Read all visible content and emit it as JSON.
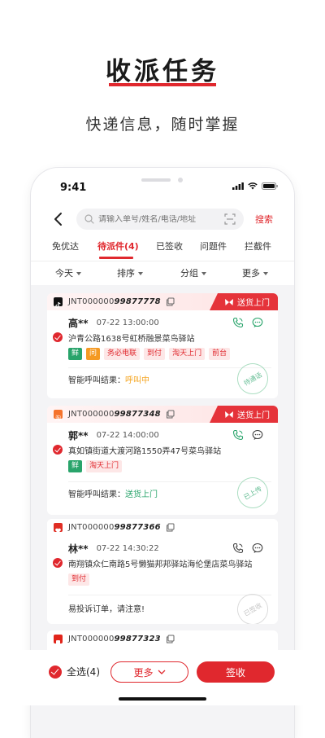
{
  "hero": {
    "title": "收派任务",
    "subtitle": "快递信息，随时掌握"
  },
  "status_bar": {
    "time": "9:41"
  },
  "search": {
    "placeholder": "请输入单号/姓名/电话/地址",
    "search_label": "搜索"
  },
  "tabs": [
    {
      "label": "免优达",
      "active": false
    },
    {
      "label": "待派件(4)",
      "active": true
    },
    {
      "label": "已签收",
      "active": false
    },
    {
      "label": "问题件",
      "active": false
    },
    {
      "label": "拦截件",
      "active": false
    }
  ],
  "filters": [
    "今天",
    "排序",
    "分组",
    "更多"
  ],
  "cards": [
    {
      "brand_icon": "tiktok-icon",
      "waybill_prefix": "JNT000000",
      "waybill_suffix": "99877778",
      "ribbon": "送货上门",
      "name": "高**",
      "time": "07-22 13:00:00",
      "address": "沪青公路1638号虹桥融景菜鸟驿站",
      "tags": [
        {
          "text": "鲜",
          "style": "green"
        },
        {
          "text": "问",
          "style": "orange"
        },
        {
          "text": "务必电联",
          "style": "red"
        },
        {
          "text": "到付",
          "style": "red"
        },
        {
          "text": "淘天上门",
          "style": "red"
        },
        {
          "text": "前台",
          "style": "red"
        }
      ],
      "result_label": "智能呼叫结果：",
      "result_value": "呼叫中",
      "stamp": "待通话"
    },
    {
      "brand_icon": "taobao-icon",
      "waybill_prefix": "JNT000000",
      "waybill_suffix": "99877348",
      "ribbon": "送货上门",
      "name": "郭**",
      "time": "07-22 14:00:00",
      "address": "真如镇街道大渡河路1550弄47号菜鸟驿站",
      "tags": [
        {
          "text": "鲜",
          "style": "green"
        },
        {
          "text": "淘天上门",
          "style": "red"
        }
      ],
      "result_label": "智能呼叫结果：",
      "result_value": "送货上门",
      "stamp": "已上传"
    },
    {
      "brand_icon": "pinduoduo-icon",
      "waybill_prefix": "JNT000000",
      "waybill_suffix": "99877366",
      "name": "林**",
      "time": "07-22 14:30:22",
      "address": "南翔镇众仁南路5号懒猫邦邦驿站海伦堡店菜鸟驿站",
      "tags": [
        {
          "text": "到付",
          "style": "red"
        }
      ],
      "result_label": "易投诉订单，请注意!",
      "stamp": "已签收"
    },
    {
      "brand_icon": "jd-icon",
      "waybill_prefix": "JNT000000",
      "waybill_suffix": "99877323"
    }
  ],
  "bottom": {
    "select_all": "全选(4)",
    "more": "更多",
    "sign": "签收"
  },
  "colors": {
    "accent": "#e0282e",
    "green": "#29a46b",
    "orange": "#f5a623"
  }
}
